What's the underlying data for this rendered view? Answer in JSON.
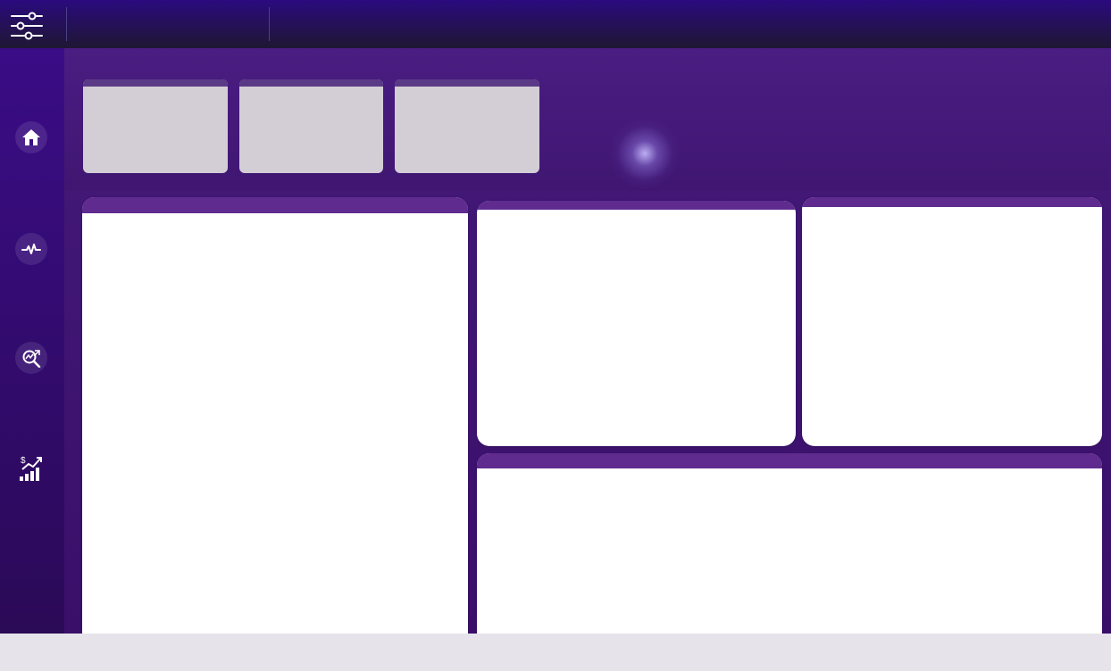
{
  "app": {
    "colors": {
      "topbar": "#2b0a7e",
      "sidebar": "#3a0c86",
      "content": "#441a7a",
      "panel_header": "#5f2b8e",
      "kpi_card": "#d3ced6"
    }
  },
  "toolbar": {
    "menu_icon": "sliders-icon"
  },
  "sidebar": {
    "items": [
      {
        "name": "home",
        "icon": "home-icon"
      },
      {
        "name": "activity",
        "icon": "pulse-icon"
      },
      {
        "name": "analysis",
        "icon": "search-chart-icon"
      },
      {
        "name": "revenue",
        "icon": "growth-chart-icon"
      }
    ]
  },
  "kpis": [
    {
      "label": "",
      "value": ""
    },
    {
      "label": "",
      "value": ""
    },
    {
      "label": "",
      "value": ""
    }
  ],
  "panels": [
    {
      "title": ""
    },
    {
      "title": ""
    },
    {
      "title": ""
    },
    {
      "title": ""
    }
  ]
}
